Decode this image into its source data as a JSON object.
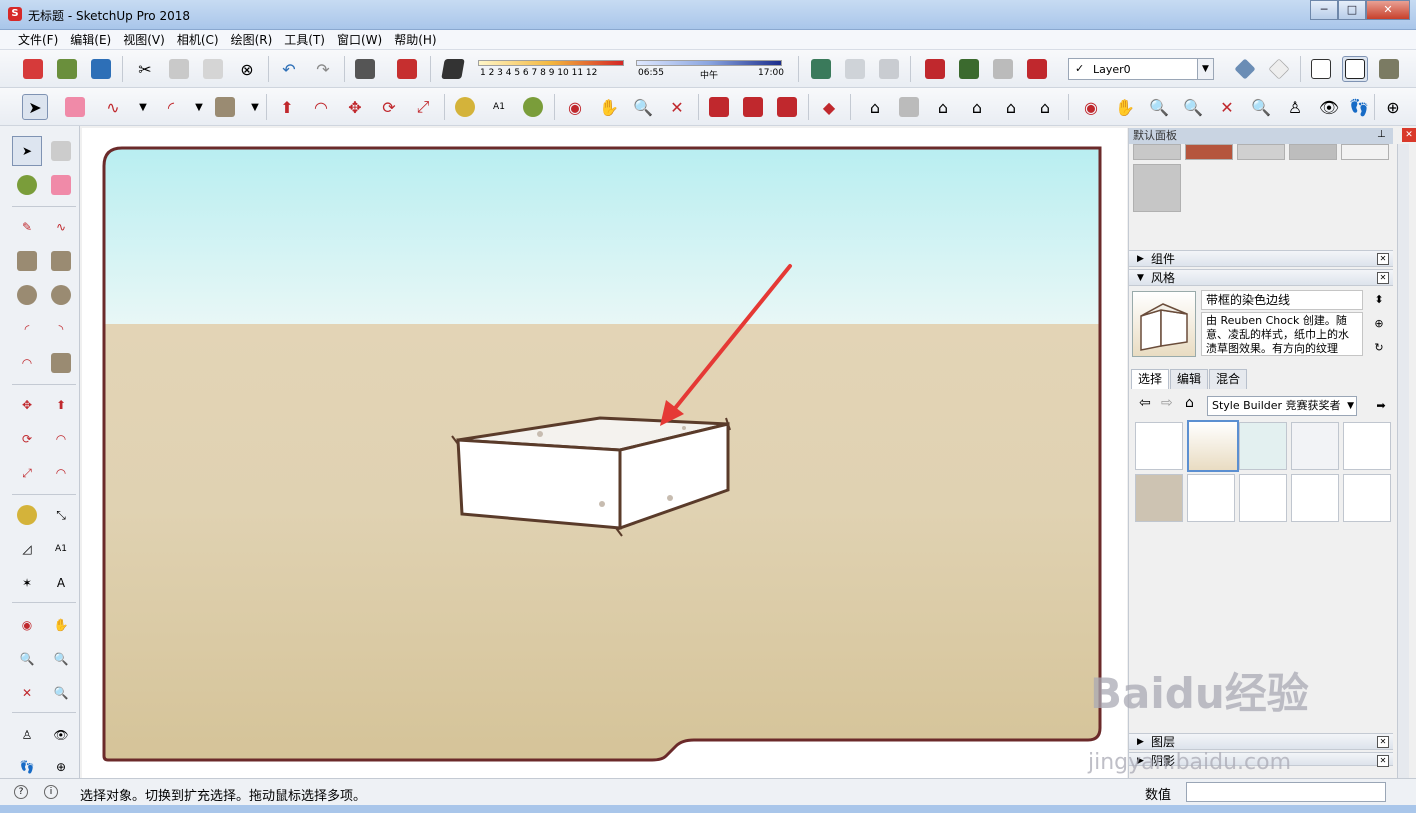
{
  "window": {
    "title": "无标题 - SketchUp Pro 2018",
    "minimize": "─",
    "maximize": "□",
    "close": "✕"
  },
  "menu": [
    "文件(F)",
    "编辑(E)",
    "视图(V)",
    "相机(C)",
    "绘图(R)",
    "工具(T)",
    "窗口(W)",
    "帮助(H)"
  ],
  "toolbar": {
    "shadow_months": "1 2 3 4 5 6 7 8 9 10 11 12",
    "time_start": "06:55",
    "time_mid": "中午",
    "time_end": "17:00",
    "layer": "Layer0"
  },
  "panel": {
    "title": "默认面板",
    "sections": {
      "components": "组件",
      "styles": "风格",
      "layers": "图层",
      "shadows": "阴影"
    },
    "style_name": "带框的染色边线",
    "style_desc": "由 Reuben Chock 创建。随意、凌乱的样式，纸巾上的水渍草图效果。有方向的纹理",
    "tabs": [
      "选择",
      "编辑",
      "混合"
    ],
    "style_collection": "Style Builder 竞赛获奖者"
  },
  "status": {
    "message": "选择对象。切换到扩充选择。拖动鼠标选择多项。",
    "measure_label": "数值"
  },
  "watermark": {
    "brand": "Baidu经验",
    "url": "jingyan.baidu.com"
  },
  "colors": {
    "sky_top": "#b3edf0",
    "ground": "#dccca7",
    "frame": "#6b2a2a",
    "arrow": "#e53935"
  }
}
